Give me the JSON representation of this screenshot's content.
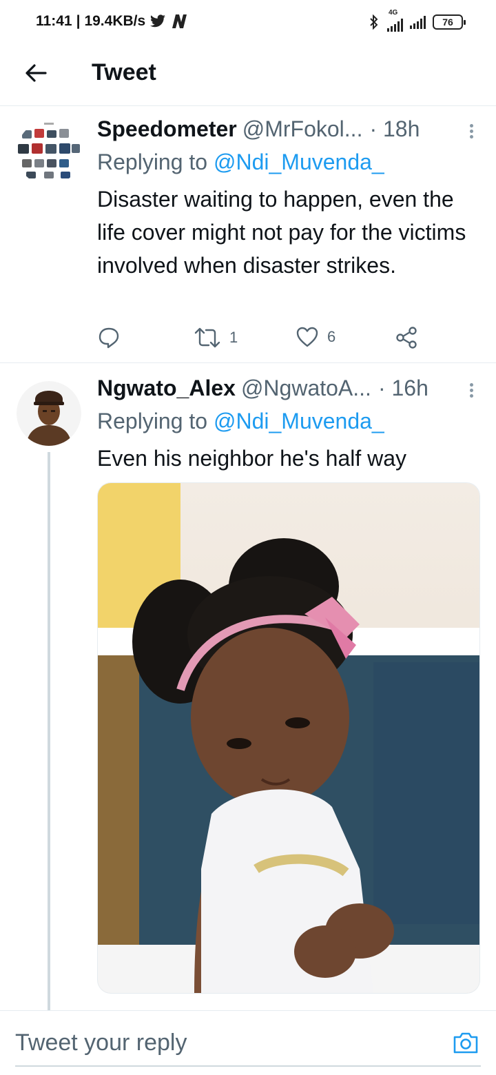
{
  "status_bar": {
    "time": "11:41",
    "separator": "|",
    "speed": "19.4KB/s",
    "network_tag": "4G",
    "battery": "76"
  },
  "header": {
    "title": "Tweet"
  },
  "tweets": [
    {
      "name": "Speedometer",
      "handle": "@MrFokol...",
      "time": "· 18h",
      "replying_label": "Replying to",
      "replying_to": "@Ndi_Muvenda_",
      "text": "Disaster waiting to happen, even the life cover might not pay for the victims involved when disaster strikes.",
      "retweets": "1",
      "likes": "6"
    },
    {
      "name": "Ngwato_Alex",
      "handle": "@NgwatoA...",
      "time": "· 16h",
      "replying_label": "Replying to",
      "replying_to": "@Ndi_Muvenda_",
      "text": "Even his neighbor he's half way"
    }
  ],
  "reply_bar": {
    "placeholder": "Tweet your reply"
  },
  "colors": {
    "accent": "#1d9bf0",
    "text": "#0f1419",
    "secondary": "#536471"
  }
}
